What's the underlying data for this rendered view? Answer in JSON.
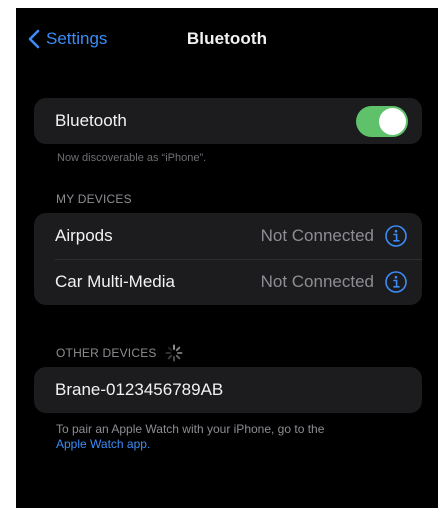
{
  "nav": {
    "back_label": "Settings",
    "title": "Bluetooth"
  },
  "bluetooth": {
    "label": "Bluetooth",
    "enabled": true,
    "discoverable_note": "Now discoverable as “iPhone”."
  },
  "my_devices": {
    "header": "MY DEVICES",
    "items": [
      {
        "name": "Airpods",
        "status": "Not Connected"
      },
      {
        "name": "Car Multi-Media",
        "status": "Not Connected"
      }
    ]
  },
  "other_devices": {
    "header": "OTHER DEVICES",
    "items": [
      {
        "name": "Brane-0123456789AB"
      }
    ]
  },
  "watch_note": {
    "text": "To pair an Apple Watch with your iPhone, go to the",
    "link": "Apple Watch app."
  },
  "colors": {
    "accent": "#3b8cf6",
    "toggle_on": "#5fc26a",
    "background": "#000000",
    "group": "#1c1c1e"
  },
  "icons": {
    "back": "chevron-left-icon",
    "info": "info-circle-icon",
    "searching": "spinner-icon"
  }
}
